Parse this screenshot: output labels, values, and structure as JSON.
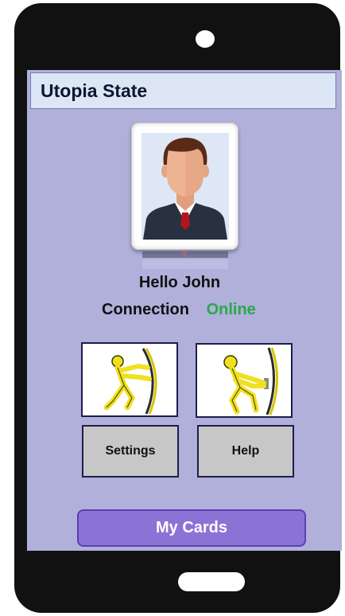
{
  "app": {
    "title": "Utopia State"
  },
  "profile": {
    "greeting": "Hello John",
    "connection_label": "Connection",
    "connection_status": "Online"
  },
  "actions": {
    "settings_label": "Settings",
    "help_label": "Help",
    "settings_icon": "person-pushing-icon",
    "help_icon": "person-pulling-icon"
  },
  "footer": {
    "my_cards_label": "My Cards"
  },
  "colors": {
    "screen_bg": "#b0b0da",
    "title_bg": "#dce6f4",
    "online": "#2aa84a",
    "my_cards_bg": "#8b73d6",
    "button_bg": "#c7c7c7"
  }
}
